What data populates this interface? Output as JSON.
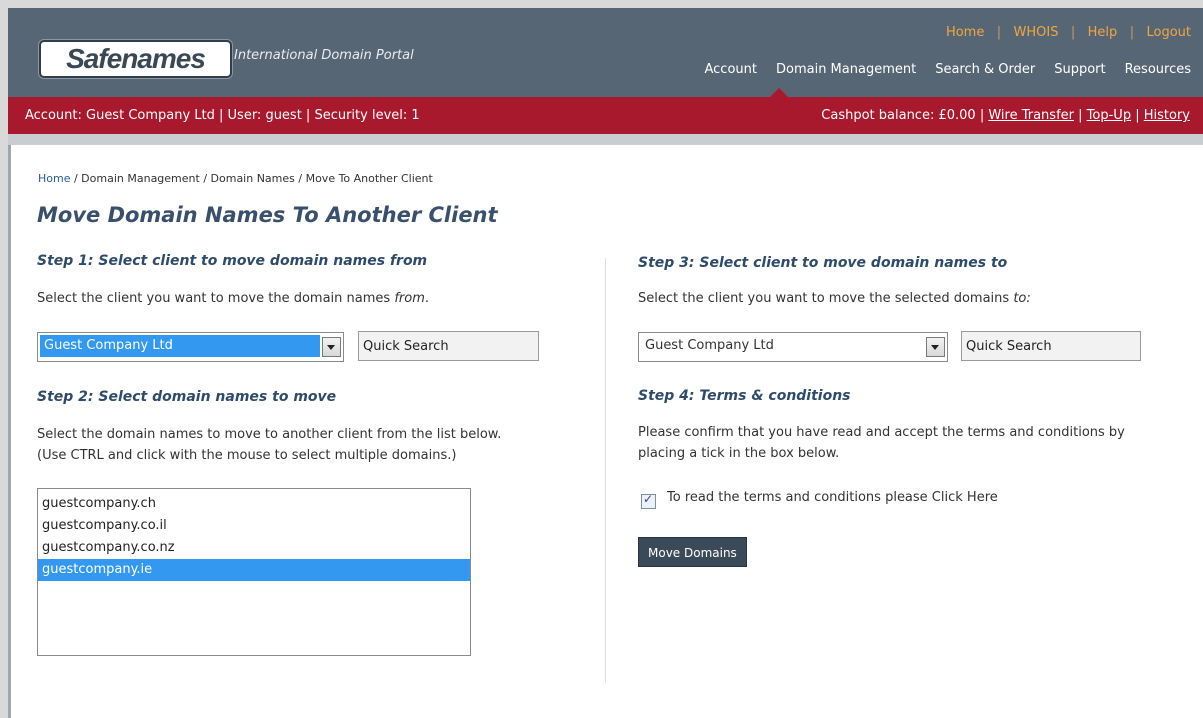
{
  "header": {
    "logo": "Safenames",
    "tagline": "International Domain Portal",
    "toplinks": [
      "Home",
      "WHOIS",
      "Help",
      "Logout"
    ],
    "nav": [
      "Account",
      "Domain Management",
      "Search & Order",
      "Support",
      "Resources"
    ]
  },
  "account_bar": {
    "account_info": "Account: Guest Company Ltd | User: guest | Security level: 1",
    "cash_prefix": "Cashpot balance: £0.00 |",
    "wire_transfer": "Wire Transfer",
    "topup": "Top-Up",
    "history": "History"
  },
  "breadcrumb": {
    "home": "Home",
    "rest": " / Domain Management / Domain Names / Move To Another Client"
  },
  "page_title": "Move Domain Names To Another Client",
  "step1": {
    "heading": "Step 1: Select client to move domain names from",
    "text_pre": "Select the client you want to move the domain names ",
    "text_em": "from",
    "text_post": ".",
    "selected_client": "Guest Company Ltd",
    "quick_search": "Quick Search"
  },
  "step2": {
    "heading": "Step 2: Select domain names to move",
    "line1": "Select the domain names to move to another client from the list below.",
    "line2": "(Use CTRL and click with the mouse to select multiple domains.)",
    "domains": [
      "guestcompany.ch",
      "guestcompany.co.il",
      "guestcompany.co.nz",
      "guestcompany.ie"
    ],
    "selected_domain": "guestcompany.ie"
  },
  "step3": {
    "heading": "Step 3: Select client to move domain names to",
    "text_pre": "Select the client you want to move the selected domains ",
    "text_em": "to:",
    "selected_client": "Guest Company Ltd",
    "quick_search": "Quick Search"
  },
  "step4": {
    "heading": "Step 4: Terms & conditions",
    "line1": "Please confirm that you have read and accept the terms and conditions by",
    "line2": "placing a tick in the box below.",
    "checkbox_label": "To read the terms and conditions please Click Here",
    "checked": true,
    "button": "Move Domains"
  }
}
